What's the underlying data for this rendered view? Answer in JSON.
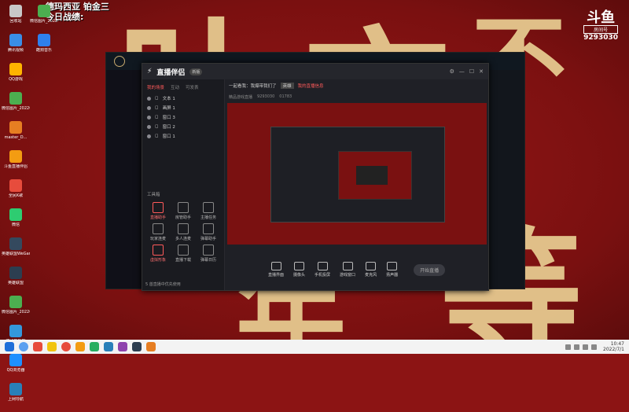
{
  "overlay_note": {
    "line1": "德玛西亚 铂金三",
    "line2": "今日战绩:"
  },
  "watermark": {
    "logo": "斗鱼",
    "badge": "房间号",
    "room": "9293030"
  },
  "desktop_icons_left": [
    {
      "label": "回收站",
      "color": "#c8c8c8"
    },
    {
      "label": "腾讯视频",
      "color": "#3a8ee6"
    },
    {
      "label": "QQ游戏",
      "color": "#ffb400"
    },
    {
      "label": "微信图片_20220410...",
      "color": "#4caf50"
    },
    {
      "label": "master_D...",
      "color": "#e67e22"
    },
    {
      "label": "斗鱼直播伴侣",
      "color": "#f39c12"
    },
    {
      "label": "全民K歌",
      "color": "#e74c3c"
    },
    {
      "label": "微信",
      "color": "#2ecc71"
    },
    {
      "label": "英雄联盟WeGame版",
      "color": "#34495e"
    },
    {
      "label": "英雄联盟",
      "color": "#2c3e50"
    },
    {
      "label": "微信图片_20220410...",
      "color": "#4caf50"
    },
    {
      "label": "腾讯影视库",
      "color": "#3498db"
    },
    {
      "label": "QQ浏览器",
      "color": "#1e90ff"
    },
    {
      "label": "上网导航",
      "color": "#2980b9"
    }
  ],
  "desktop_icons_col2": [
    {
      "label": "微信图片_202206...",
      "color": "#4caf50"
    },
    {
      "label": "酷狗音乐",
      "color": "#2f80ed"
    }
  ],
  "app": {
    "brand": "直播伴侣",
    "version": "新版",
    "tabs": [
      "我的场景",
      "互动",
      "可发表"
    ],
    "scenes": [
      "文本 1",
      "画屏 1",
      "窗口 3",
      "窗口 2",
      "窗口 1"
    ],
    "tools_title": "工具箱",
    "tools": [
      {
        "label": "直播助手",
        "active": true
      },
      {
        "label": "房管助手",
        "active": false
      },
      {
        "label": "主播任务",
        "active": false
      },
      {
        "label": "玩家连麦",
        "active": false
      },
      {
        "label": "多人连麦",
        "active": false
      },
      {
        "label": "弹幕助手",
        "active": false
      },
      {
        "label": "虚拟形象",
        "active": true
      },
      {
        "label": "直播下载",
        "active": false
      },
      {
        "label": "弹幕日历",
        "active": false
      }
    ],
    "scene_foot": "5 首直播中优先使用",
    "header_title": "一起看我：我爆带我们了",
    "header_tag": "英雄",
    "header_red": "我的直播信息",
    "subrow": [
      "精品游戏直播",
      "9293030",
      "01783"
    ],
    "bottom": [
      {
        "label": "直播界面"
      },
      {
        "label": "摄像头"
      },
      {
        "label": "手机投屏"
      },
      {
        "label": "游戏窗口"
      },
      {
        "label": "麦克风"
      },
      {
        "label": "扬声器"
      }
    ],
    "start_label": "开始直播"
  },
  "taskbar": {
    "time": "10:47",
    "date": "2022/7/1"
  }
}
